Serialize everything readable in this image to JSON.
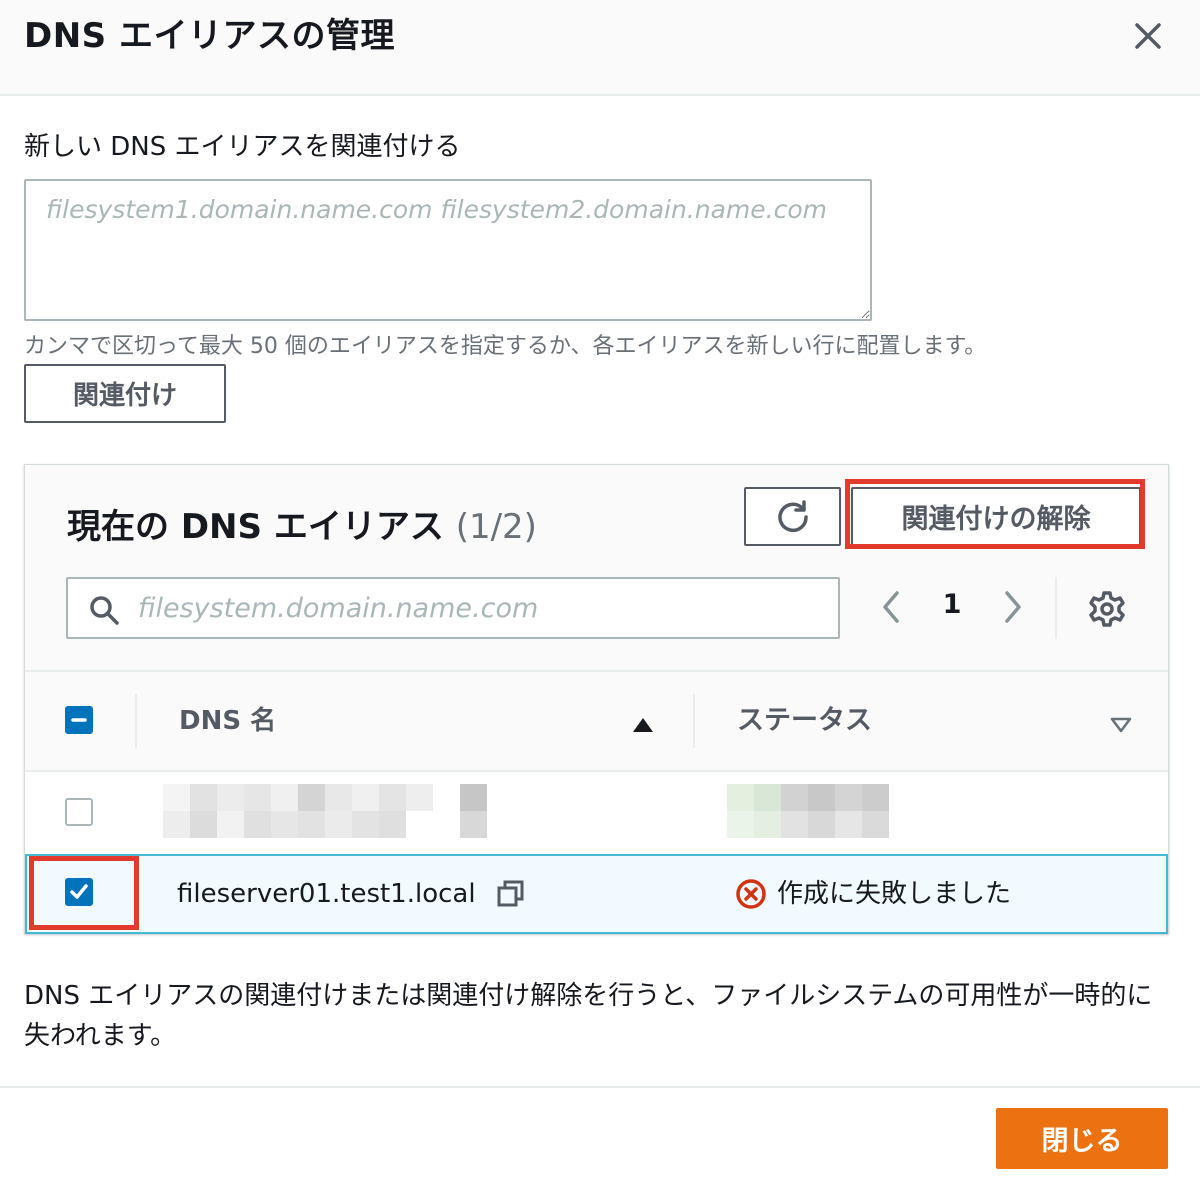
{
  "modal": {
    "title": "DNS エイリアスの管理"
  },
  "new_alias": {
    "label": "新しい DNS エイリアスを関連付ける",
    "placeholder": "filesystem1.domain.name.com filesystem2.domain.name.com",
    "value": "",
    "hint": "カンマで区切って最大 50 個のエイリアスを指定するか、各エイリアスを新しい行に配置します。",
    "associate_label": "関連付け"
  },
  "current_aliases": {
    "heading": "現在の DNS エイリアス",
    "count": "(1/2)",
    "disassociate_label": "関連付けの解除",
    "search_placeholder": "filesystem.domain.name.com",
    "page": "1",
    "columns": {
      "name": "DNS 名",
      "status": "ステータス"
    },
    "rows": [
      {
        "name": "",
        "status": "",
        "selected": false,
        "redacted": true
      },
      {
        "name": "fileserver01.test1.local",
        "status": "作成に失敗しました",
        "status_icon": "error-icon",
        "selected": true
      }
    ]
  },
  "warning": {
    "text": "DNS エイリアスの関連付けまたは関連付け解除を行うと、ファイルシステムの可用性が一時的に失われます。"
  },
  "footer": {
    "close_label": "閉じる"
  },
  "colors": {
    "primary": "#ec7211",
    "selection": "#0073bb",
    "highlight": "#e23a2c",
    "error": "#d13212"
  }
}
